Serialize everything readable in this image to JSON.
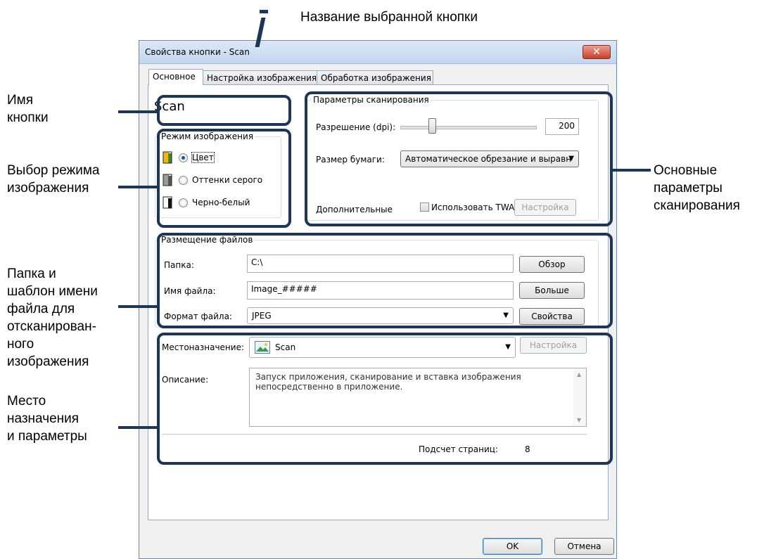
{
  "callouts": {
    "button_name_title": "Название выбранной кнопки",
    "button_name_1": "Имя",
    "button_name_2": "кнопки",
    "mode_1": "Выбор режима",
    "mode_2": "изображения",
    "scan_1": "Основные",
    "scan_2": "параметры",
    "scan_3": "сканирования",
    "folder_1": "Папка и",
    "folder_2": "шаблон имени",
    "folder_3": "файла для",
    "folder_4": "отсканирован-",
    "folder_5": "ного",
    "folder_6": "изображения",
    "dest_1": "Место",
    "dest_2": "назначения",
    "dest_3": "и параметры"
  },
  "dialog": {
    "title": "Свойства кнопки - Scan",
    "close_glyph": "✕",
    "tabs": [
      {
        "label": "Основное"
      },
      {
        "label": "Настройка изображения"
      },
      {
        "label": "Обработка изображения"
      }
    ],
    "button_name": "Scan",
    "image_mode": {
      "title": "Режим изображения",
      "options": [
        {
          "label": "Цвет",
          "selected": true
        },
        {
          "label": "Оттенки серого",
          "selected": false
        },
        {
          "label": "Черно-белый",
          "selected": false
        }
      ]
    },
    "scan_params": {
      "title": "Параметры сканирования",
      "resolution_label": "Разрешение (dpi):",
      "resolution_value": "200",
      "paper_label": "Размер бумаги:",
      "paper_value": "Автоматическое обрезание и выравн",
      "advanced_label": "Дополнительные",
      "twain_label": "Использовать TWAIN",
      "settings_label": "Настройка"
    },
    "file_location": {
      "title": "Размещение файлов",
      "folder_label": "Папка:",
      "folder_value": "C:\\",
      "browse_label": "Обзор",
      "filename_label": "Имя файла:",
      "filename_value": "Image_#####",
      "more_label": "Больше",
      "format_label": "Формат файла:",
      "format_value": "JPEG",
      "properties_label": "Свойства"
    },
    "destination": {
      "label": "Местоназначение:",
      "value": "Scan",
      "settings_label": "Настройка",
      "description_label": "Описание:",
      "description_line1": "Запуск приложения, сканирование и вставка изображения",
      "description_line2": "непосредственно в приложение.",
      "page_count_label": "Подсчет страниц:",
      "page_count_value": "8"
    },
    "ok_label": "OK",
    "cancel_label": "Отмена"
  }
}
